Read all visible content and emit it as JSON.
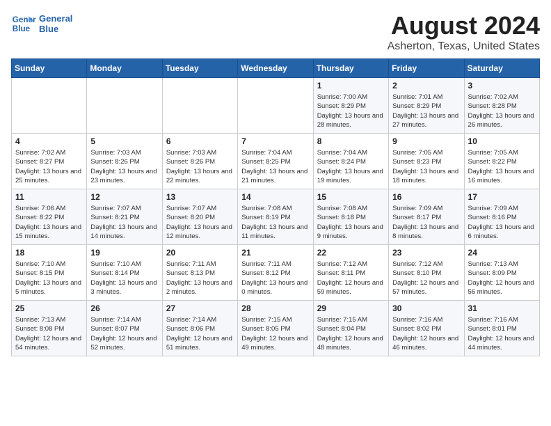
{
  "header": {
    "logo_line1": "General",
    "logo_line2": "Blue",
    "month_year": "August 2024",
    "location": "Asherton, Texas, United States"
  },
  "weekdays": [
    "Sunday",
    "Monday",
    "Tuesday",
    "Wednesday",
    "Thursday",
    "Friday",
    "Saturday"
  ],
  "weeks": [
    [
      {
        "day": "",
        "sunrise": "",
        "sunset": "",
        "daylight": ""
      },
      {
        "day": "",
        "sunrise": "",
        "sunset": "",
        "daylight": ""
      },
      {
        "day": "",
        "sunrise": "",
        "sunset": "",
        "daylight": ""
      },
      {
        "day": "",
        "sunrise": "",
        "sunset": "",
        "daylight": ""
      },
      {
        "day": "1",
        "sunrise": "Sunrise: 7:00 AM",
        "sunset": "Sunset: 8:29 PM",
        "daylight": "Daylight: 13 hours and 28 minutes."
      },
      {
        "day": "2",
        "sunrise": "Sunrise: 7:01 AM",
        "sunset": "Sunset: 8:29 PM",
        "daylight": "Daylight: 13 hours and 27 minutes."
      },
      {
        "day": "3",
        "sunrise": "Sunrise: 7:02 AM",
        "sunset": "Sunset: 8:28 PM",
        "daylight": "Daylight: 13 hours and 26 minutes."
      }
    ],
    [
      {
        "day": "4",
        "sunrise": "Sunrise: 7:02 AM",
        "sunset": "Sunset: 8:27 PM",
        "daylight": "Daylight: 13 hours and 25 minutes."
      },
      {
        "day": "5",
        "sunrise": "Sunrise: 7:03 AM",
        "sunset": "Sunset: 8:26 PM",
        "daylight": "Daylight: 13 hours and 23 minutes."
      },
      {
        "day": "6",
        "sunrise": "Sunrise: 7:03 AM",
        "sunset": "Sunset: 8:26 PM",
        "daylight": "Daylight: 13 hours and 22 minutes."
      },
      {
        "day": "7",
        "sunrise": "Sunrise: 7:04 AM",
        "sunset": "Sunset: 8:25 PM",
        "daylight": "Daylight: 13 hours and 21 minutes."
      },
      {
        "day": "8",
        "sunrise": "Sunrise: 7:04 AM",
        "sunset": "Sunset: 8:24 PM",
        "daylight": "Daylight: 13 hours and 19 minutes."
      },
      {
        "day": "9",
        "sunrise": "Sunrise: 7:05 AM",
        "sunset": "Sunset: 8:23 PM",
        "daylight": "Daylight: 13 hours and 18 minutes."
      },
      {
        "day": "10",
        "sunrise": "Sunrise: 7:05 AM",
        "sunset": "Sunset: 8:22 PM",
        "daylight": "Daylight: 13 hours and 16 minutes."
      }
    ],
    [
      {
        "day": "11",
        "sunrise": "Sunrise: 7:06 AM",
        "sunset": "Sunset: 8:22 PM",
        "daylight": "Daylight: 13 hours and 15 minutes."
      },
      {
        "day": "12",
        "sunrise": "Sunrise: 7:07 AM",
        "sunset": "Sunset: 8:21 PM",
        "daylight": "Daylight: 13 hours and 14 minutes."
      },
      {
        "day": "13",
        "sunrise": "Sunrise: 7:07 AM",
        "sunset": "Sunset: 8:20 PM",
        "daylight": "Daylight: 13 hours and 12 minutes."
      },
      {
        "day": "14",
        "sunrise": "Sunrise: 7:08 AM",
        "sunset": "Sunset: 8:19 PM",
        "daylight": "Daylight: 13 hours and 11 minutes."
      },
      {
        "day": "15",
        "sunrise": "Sunrise: 7:08 AM",
        "sunset": "Sunset: 8:18 PM",
        "daylight": "Daylight: 13 hours and 9 minutes."
      },
      {
        "day": "16",
        "sunrise": "Sunrise: 7:09 AM",
        "sunset": "Sunset: 8:17 PM",
        "daylight": "Daylight: 13 hours and 8 minutes."
      },
      {
        "day": "17",
        "sunrise": "Sunrise: 7:09 AM",
        "sunset": "Sunset: 8:16 PM",
        "daylight": "Daylight: 13 hours and 6 minutes."
      }
    ],
    [
      {
        "day": "18",
        "sunrise": "Sunrise: 7:10 AM",
        "sunset": "Sunset: 8:15 PM",
        "daylight": "Daylight: 13 hours and 5 minutes."
      },
      {
        "day": "19",
        "sunrise": "Sunrise: 7:10 AM",
        "sunset": "Sunset: 8:14 PM",
        "daylight": "Daylight: 13 hours and 3 minutes."
      },
      {
        "day": "20",
        "sunrise": "Sunrise: 7:11 AM",
        "sunset": "Sunset: 8:13 PM",
        "daylight": "Daylight: 13 hours and 2 minutes."
      },
      {
        "day": "21",
        "sunrise": "Sunrise: 7:11 AM",
        "sunset": "Sunset: 8:12 PM",
        "daylight": "Daylight: 13 hours and 0 minutes."
      },
      {
        "day": "22",
        "sunrise": "Sunrise: 7:12 AM",
        "sunset": "Sunset: 8:11 PM",
        "daylight": "Daylight: 12 hours and 59 minutes."
      },
      {
        "day": "23",
        "sunrise": "Sunrise: 7:12 AM",
        "sunset": "Sunset: 8:10 PM",
        "daylight": "Daylight: 12 hours and 57 minutes."
      },
      {
        "day": "24",
        "sunrise": "Sunrise: 7:13 AM",
        "sunset": "Sunset: 8:09 PM",
        "daylight": "Daylight: 12 hours and 56 minutes."
      }
    ],
    [
      {
        "day": "25",
        "sunrise": "Sunrise: 7:13 AM",
        "sunset": "Sunset: 8:08 PM",
        "daylight": "Daylight: 12 hours and 54 minutes."
      },
      {
        "day": "26",
        "sunrise": "Sunrise: 7:14 AM",
        "sunset": "Sunset: 8:07 PM",
        "daylight": "Daylight: 12 hours and 52 minutes."
      },
      {
        "day": "27",
        "sunrise": "Sunrise: 7:14 AM",
        "sunset": "Sunset: 8:06 PM",
        "daylight": "Daylight: 12 hours and 51 minutes."
      },
      {
        "day": "28",
        "sunrise": "Sunrise: 7:15 AM",
        "sunset": "Sunset: 8:05 PM",
        "daylight": "Daylight: 12 hours and 49 minutes."
      },
      {
        "day": "29",
        "sunrise": "Sunrise: 7:15 AM",
        "sunset": "Sunset: 8:04 PM",
        "daylight": "Daylight: 12 hours and 48 minutes."
      },
      {
        "day": "30",
        "sunrise": "Sunrise: 7:16 AM",
        "sunset": "Sunset: 8:02 PM",
        "daylight": "Daylight: 12 hours and 46 minutes."
      },
      {
        "day": "31",
        "sunrise": "Sunrise: 7:16 AM",
        "sunset": "Sunset: 8:01 PM",
        "daylight": "Daylight: 12 hours and 44 minutes."
      }
    ]
  ]
}
